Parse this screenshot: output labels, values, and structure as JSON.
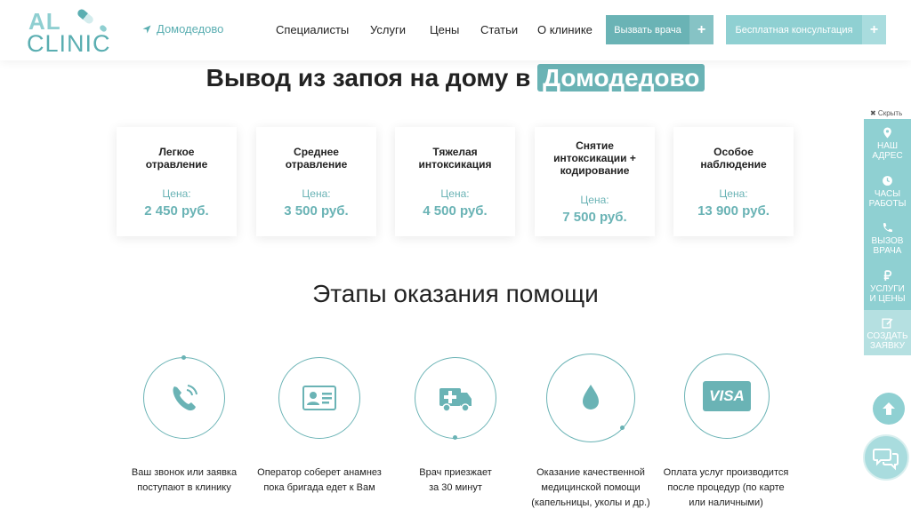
{
  "header": {
    "logo_top": "AL",
    "logo_bottom": "CLINIC",
    "city": "Домодедово",
    "nav": [
      "Специалисты",
      "Услуги",
      "Цены",
      "Статьи",
      "О клинике"
    ],
    "call_button": "Вызвать врача",
    "consult_button": "Бесплатная консультация",
    "plus": "+"
  },
  "hero": {
    "title_prefix": "Вывод из запоя на дому в",
    "title_city": "Домодедово"
  },
  "price_label": "Цена:",
  "prices": [
    {
      "title_line1": "Легкое",
      "title_line2": "отравление",
      "title_line3": "",
      "price": "2 450 руб."
    },
    {
      "title_line1": "Среднее",
      "title_line2": "отравление",
      "title_line3": "",
      "price": "3 500 руб."
    },
    {
      "title_line1": "Тяжелая",
      "title_line2": "интоксикация",
      "title_line3": "",
      "price": "4 500 руб."
    },
    {
      "title_line1": "Снятие",
      "title_line2": "интоксикации +",
      "title_line3": "кодирование",
      "price": "7 500 руб."
    },
    {
      "title_line1": "Особое",
      "title_line2": "наблюдение",
      "title_line3": "",
      "price": "13 900 руб."
    }
  ],
  "steps_title": "Этапы оказания помощи",
  "steps": [
    {
      "line1": "Ваш звонок или заявка",
      "line2": "поступают в клинику",
      "line3": ""
    },
    {
      "line1": "Оператор соберет анамнез",
      "line2": "пока бригада едет к Вам",
      "line3": ""
    },
    {
      "line1": "Врач приезжает",
      "line2": "за 30 минут",
      "line3": ""
    },
    {
      "line1": "Оказание качественной",
      "line2": "медицинской помощи",
      "line3": "(капельницы, уколы и др.)"
    },
    {
      "line1": "Оплата услуг производится",
      "line2": "после процедур (по карте",
      "line3": "или наличными)"
    }
  ],
  "visa_text": "VISA",
  "sidebar": {
    "hide": "✖ Скрыть",
    "items": [
      {
        "line1": "НАШ",
        "line2": "АДРЕС"
      },
      {
        "line1": "ЧАСЫ",
        "line2": "РАБОТЫ"
      },
      {
        "line1": "ВЫЗОВ",
        "line2": "ВРАЧА"
      },
      {
        "line1": "УСЛУГИ",
        "line2": "И ЦЕНЫ"
      },
      {
        "line1": "СОЗДАТЬ",
        "line2": "ЗАЯВКУ"
      }
    ]
  },
  "colors": {
    "accent": "#6ab3b5",
    "accent_light": "#8fd0d2"
  }
}
